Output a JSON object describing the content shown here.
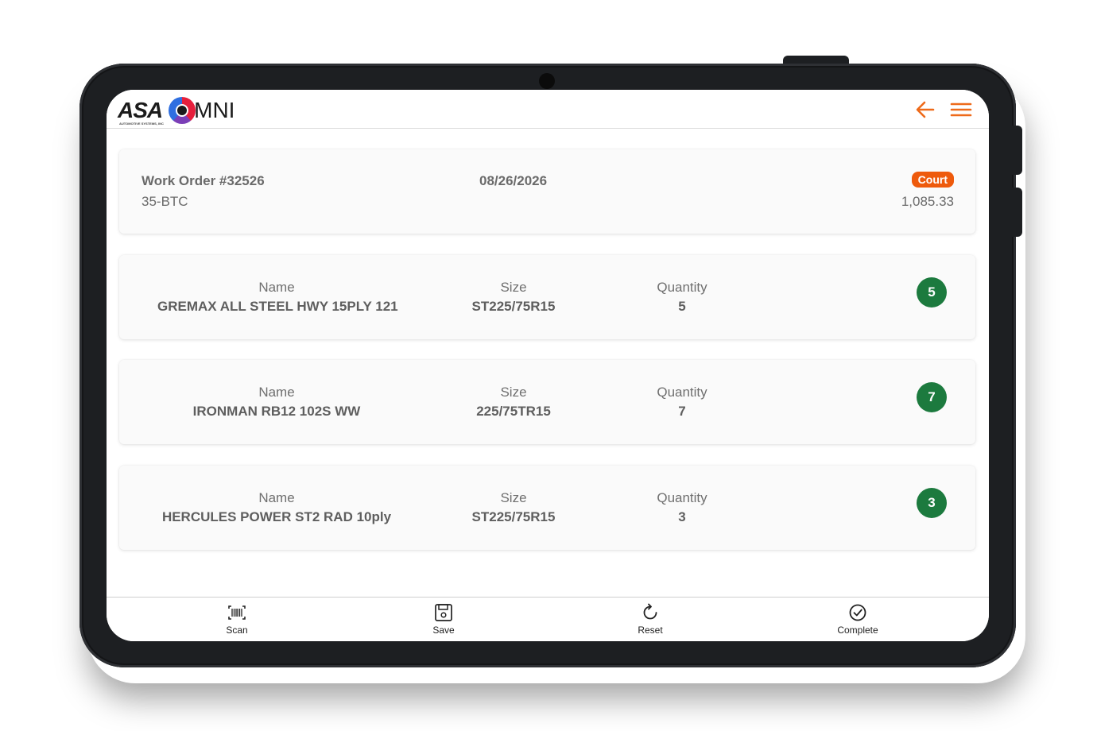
{
  "app": {
    "logo_brand": "ASA",
    "logo_tagline": "AUTOMOTIVE SYSTEMS, INC",
    "logo_product": "MNI"
  },
  "header": {
    "back_icon": "arrow-left-icon",
    "menu_icon": "hamburger-menu-icon",
    "accent_color": "#ee6a1a"
  },
  "work_order": {
    "title": "Work Order #32526",
    "code": "35-BTC",
    "date": "08/26/2026",
    "badge": "Court",
    "badge_color": "#ee5a0c",
    "amount": "1,085.33"
  },
  "items": [
    {
      "name_label": "Name",
      "name": "GREMAX ALL STEEL HWY 15PLY 121",
      "size_label": "Size",
      "size": "ST225/75R15",
      "qty_label": "Quantity",
      "qty": "5",
      "badge": "5"
    },
    {
      "name_label": "Name",
      "name": "IRONMAN RB12 102S WW",
      "size_label": "Size",
      "size": "225/75TR15",
      "qty_label": "Quantity",
      "qty": "7",
      "badge": "7"
    },
    {
      "name_label": "Name",
      "name": "HERCULES POWER ST2 RAD 10ply",
      "size_label": "Size",
      "size": "ST225/75R15",
      "qty_label": "Quantity",
      "qty": "3",
      "badge": "3"
    }
  ],
  "badge_color": "#1c7a3e",
  "bottom_nav": [
    {
      "label": "Scan",
      "icon": "barcode-scan-icon"
    },
    {
      "label": "Save",
      "icon": "floppy-save-icon"
    },
    {
      "label": "Reset",
      "icon": "refresh-icon"
    },
    {
      "label": "Complete",
      "icon": "check-circle-icon"
    }
  ]
}
